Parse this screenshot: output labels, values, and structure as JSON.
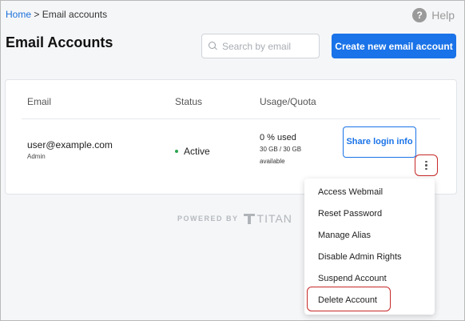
{
  "breadcrumb": {
    "home": "Home",
    "separator": ">",
    "current": "Email accounts"
  },
  "help": {
    "label": "Help",
    "icon": "help-circle-icon"
  },
  "page_title": "Email Accounts",
  "search": {
    "placeholder": "Search by email",
    "value": ""
  },
  "create_button": "Create new email account",
  "table": {
    "headers": {
      "email": "Email",
      "status": "Status",
      "usage": "Usage/Quota"
    },
    "rows": [
      {
        "email": "user@example.com",
        "role": "Admin",
        "status": "Active",
        "usage_percent": "0 % used",
        "quota": "30 GB / 30 GB",
        "available": "available",
        "share_button": "Share login info"
      }
    ]
  },
  "powered_by": {
    "label": "POWERED BY",
    "brand": "TITAN"
  },
  "context_menu": {
    "items": [
      "Access Webmail",
      "Reset Password",
      "Manage Alias",
      "Disable Admin Rights",
      "Suspend Account",
      "Delete Account"
    ]
  },
  "colors": {
    "primary": "#1a73e8",
    "highlight": "#c62828",
    "active": "#2ea44f"
  }
}
